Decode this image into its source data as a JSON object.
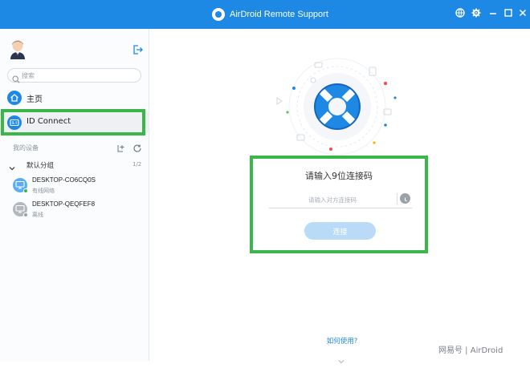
{
  "titlebar": {
    "title": "AirDroid Remote Support",
    "color": "#1e88e5",
    "buttons": [
      "globe-icon",
      "gear-icon",
      "minimize-icon",
      "maximize-icon",
      "close-icon"
    ]
  },
  "sidebar": {
    "search_placeholder": "搜索",
    "nav": [
      {
        "label": "主页",
        "icon": "home-icon"
      },
      {
        "label": "ID Connect",
        "icon": "id-card-icon",
        "active": true
      }
    ],
    "devices_section_label": "我的设备",
    "group": {
      "label": "默认分组",
      "count": "1/2"
    },
    "devices": [
      {
        "name": "DESKTOP-CO6CQ0S",
        "status": "有线网络",
        "online": true
      },
      {
        "name": "DESKTOP-QEQFEF8",
        "status": "离线",
        "online": false
      }
    ]
  },
  "main": {
    "prompt": "请输入9位连接码",
    "code_placeholder": "请输入对方连接码",
    "connect_label": "连接",
    "help_link": "如何使用?"
  },
  "watermark": "网易号 | AirDroid",
  "colors": {
    "accent": "#1e88e5",
    "highlight_box": "#3cb64a",
    "button_disabled": "#b9dbf8"
  }
}
